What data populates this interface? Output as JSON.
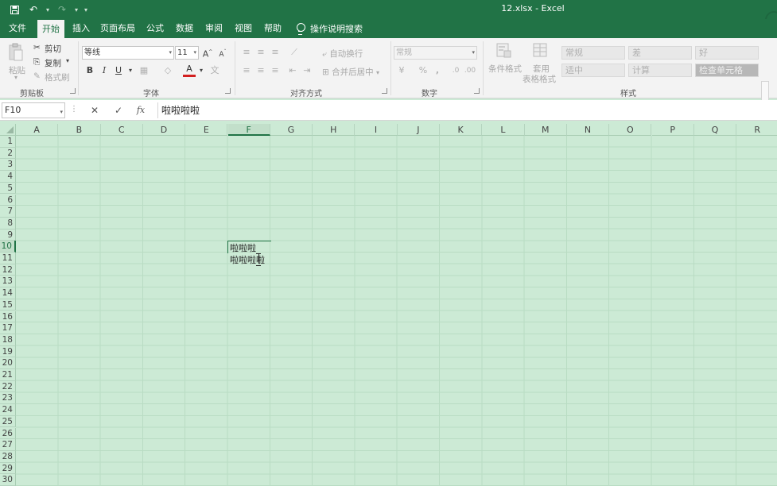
{
  "window": {
    "title": "12.xlsx  -  Excel"
  },
  "qat": {
    "undo": "↶",
    "redo": "↷"
  },
  "tabs": [
    {
      "label": "文件",
      "active": false
    },
    {
      "label": "开始",
      "active": true
    },
    {
      "label": "插入",
      "active": false
    },
    {
      "label": "页面布局",
      "active": false
    },
    {
      "label": "公式",
      "active": false
    },
    {
      "label": "数据",
      "active": false
    },
    {
      "label": "审阅",
      "active": false
    },
    {
      "label": "视图",
      "active": false
    },
    {
      "label": "帮助",
      "active": false
    }
  ],
  "tellme": "操作说明搜索",
  "ribbon": {
    "clipboard": {
      "paste": "粘贴",
      "cut": "剪切",
      "copy": "复制",
      "format_painter": "格式刷",
      "label": "剪贴板"
    },
    "font": {
      "name": "等线",
      "size": "11",
      "bold": "B",
      "italic": "I",
      "underline": "U",
      "grow": "A",
      "shrink": "A",
      "font_color": "A",
      "label": "字体"
    },
    "alignment": {
      "wrap": "自动换行",
      "merge": "合并后居中",
      "label": "对齐方式"
    },
    "number": {
      "format": "常规",
      "percent": "%",
      "comma": ",",
      "label": "数字"
    },
    "styles": {
      "cond_format": "条件格式",
      "table_format_1": "套用",
      "table_format_2": "表格格式",
      "cells": [
        "常规",
        "差",
        "好",
        "适中",
        "计算",
        "检查单元格"
      ],
      "label": "样式"
    }
  },
  "formula_bar": {
    "name_box": "F10",
    "cancel": "✕",
    "enter": "✓",
    "fx": "fx",
    "content": "啦啦啦啦"
  },
  "sheet": {
    "columns": [
      "A",
      "B",
      "C",
      "D",
      "E",
      "F",
      "G",
      "H",
      "I",
      "J",
      "K",
      "L",
      "M",
      "N",
      "O",
      "P",
      "Q",
      "R"
    ],
    "selected_column": "F",
    "rows": [
      "1",
      "2",
      "3",
      "4",
      "5",
      "6",
      "7",
      "8",
      "9",
      "10",
      "11",
      "12",
      "13",
      "14",
      "15",
      "16",
      "17",
      "18",
      "19",
      "20",
      "21",
      "22",
      "23",
      "24",
      "25",
      "26",
      "27",
      "28",
      "29",
      "30"
    ],
    "selected_row": "10",
    "cell_F10": "啦啦啦",
    "cell_F11": "啦啦啦啦"
  },
  "colors": {
    "brand": "#217346",
    "sheet_bg": "#ccead5"
  }
}
